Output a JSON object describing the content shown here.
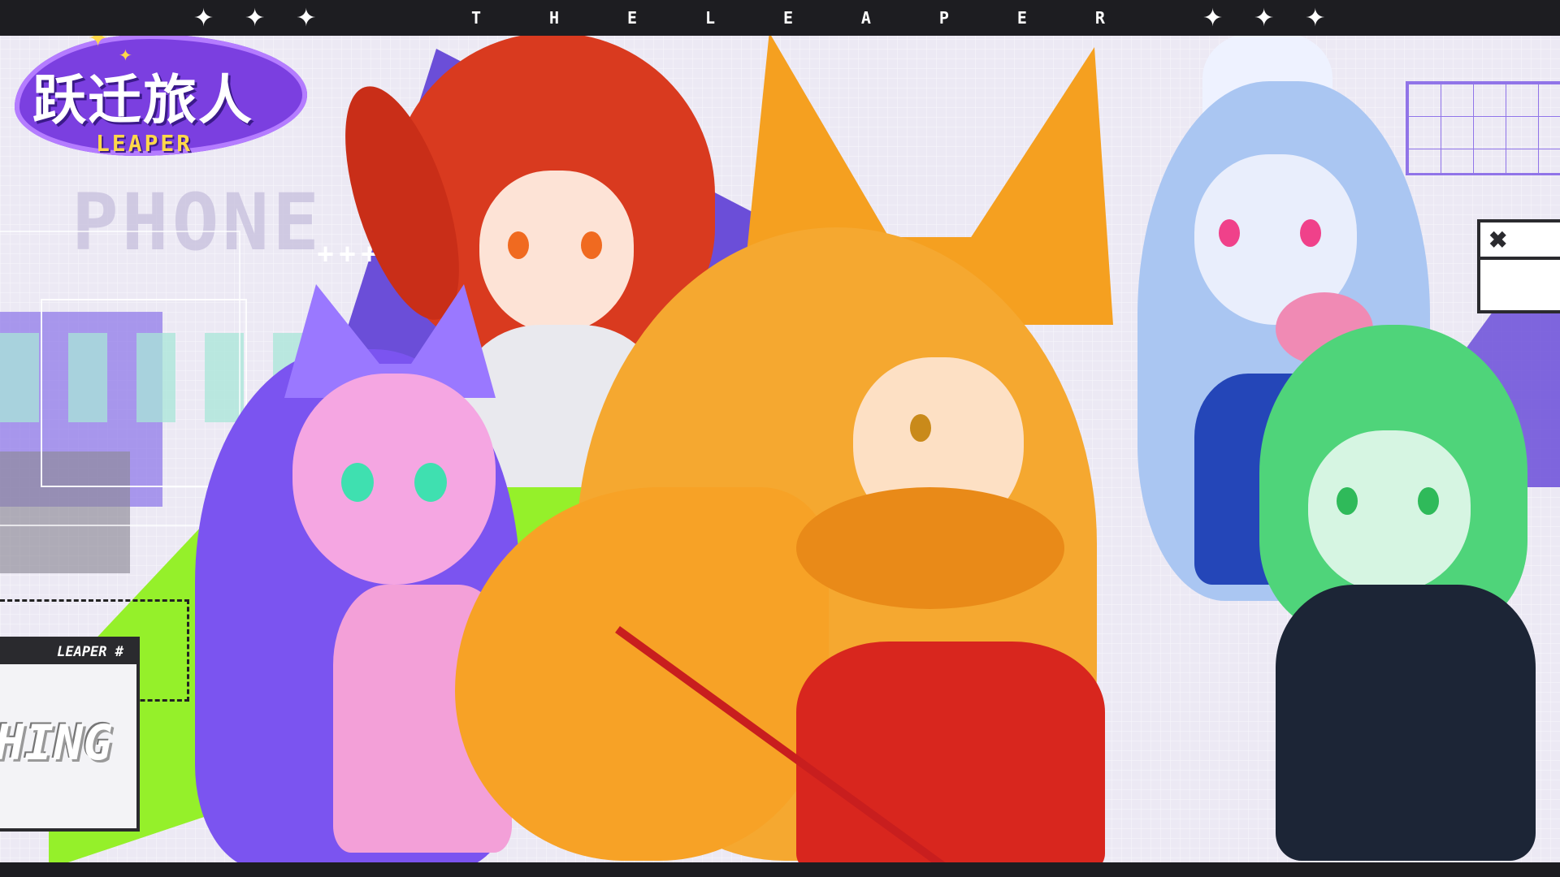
{
  "topbar": {
    "title_letters": [
      "T",
      "H",
      "E",
      "L",
      "E",
      "A",
      "P",
      "E",
      "R"
    ],
    "star_glyph": "✦"
  },
  "logo": {
    "title": "跃迁旅人",
    "subtitle": "LEAPER"
  },
  "decor": {
    "phone_text": "PHONE",
    "plus_row": "++++",
    "leaper_tag": "LEAPER #",
    "card_text": "HING",
    "window_close_glyph": "✖"
  },
  "colors": {
    "bar": "#1d1d21",
    "logo_purple": "#7b3fe0",
    "logo_gold": "#ffd84a",
    "accent_violet": "#6b4ed8",
    "accent_lime": "#95f02a"
  },
  "icons": {
    "star": "sparkle-star-icon",
    "close": "close-icon"
  }
}
